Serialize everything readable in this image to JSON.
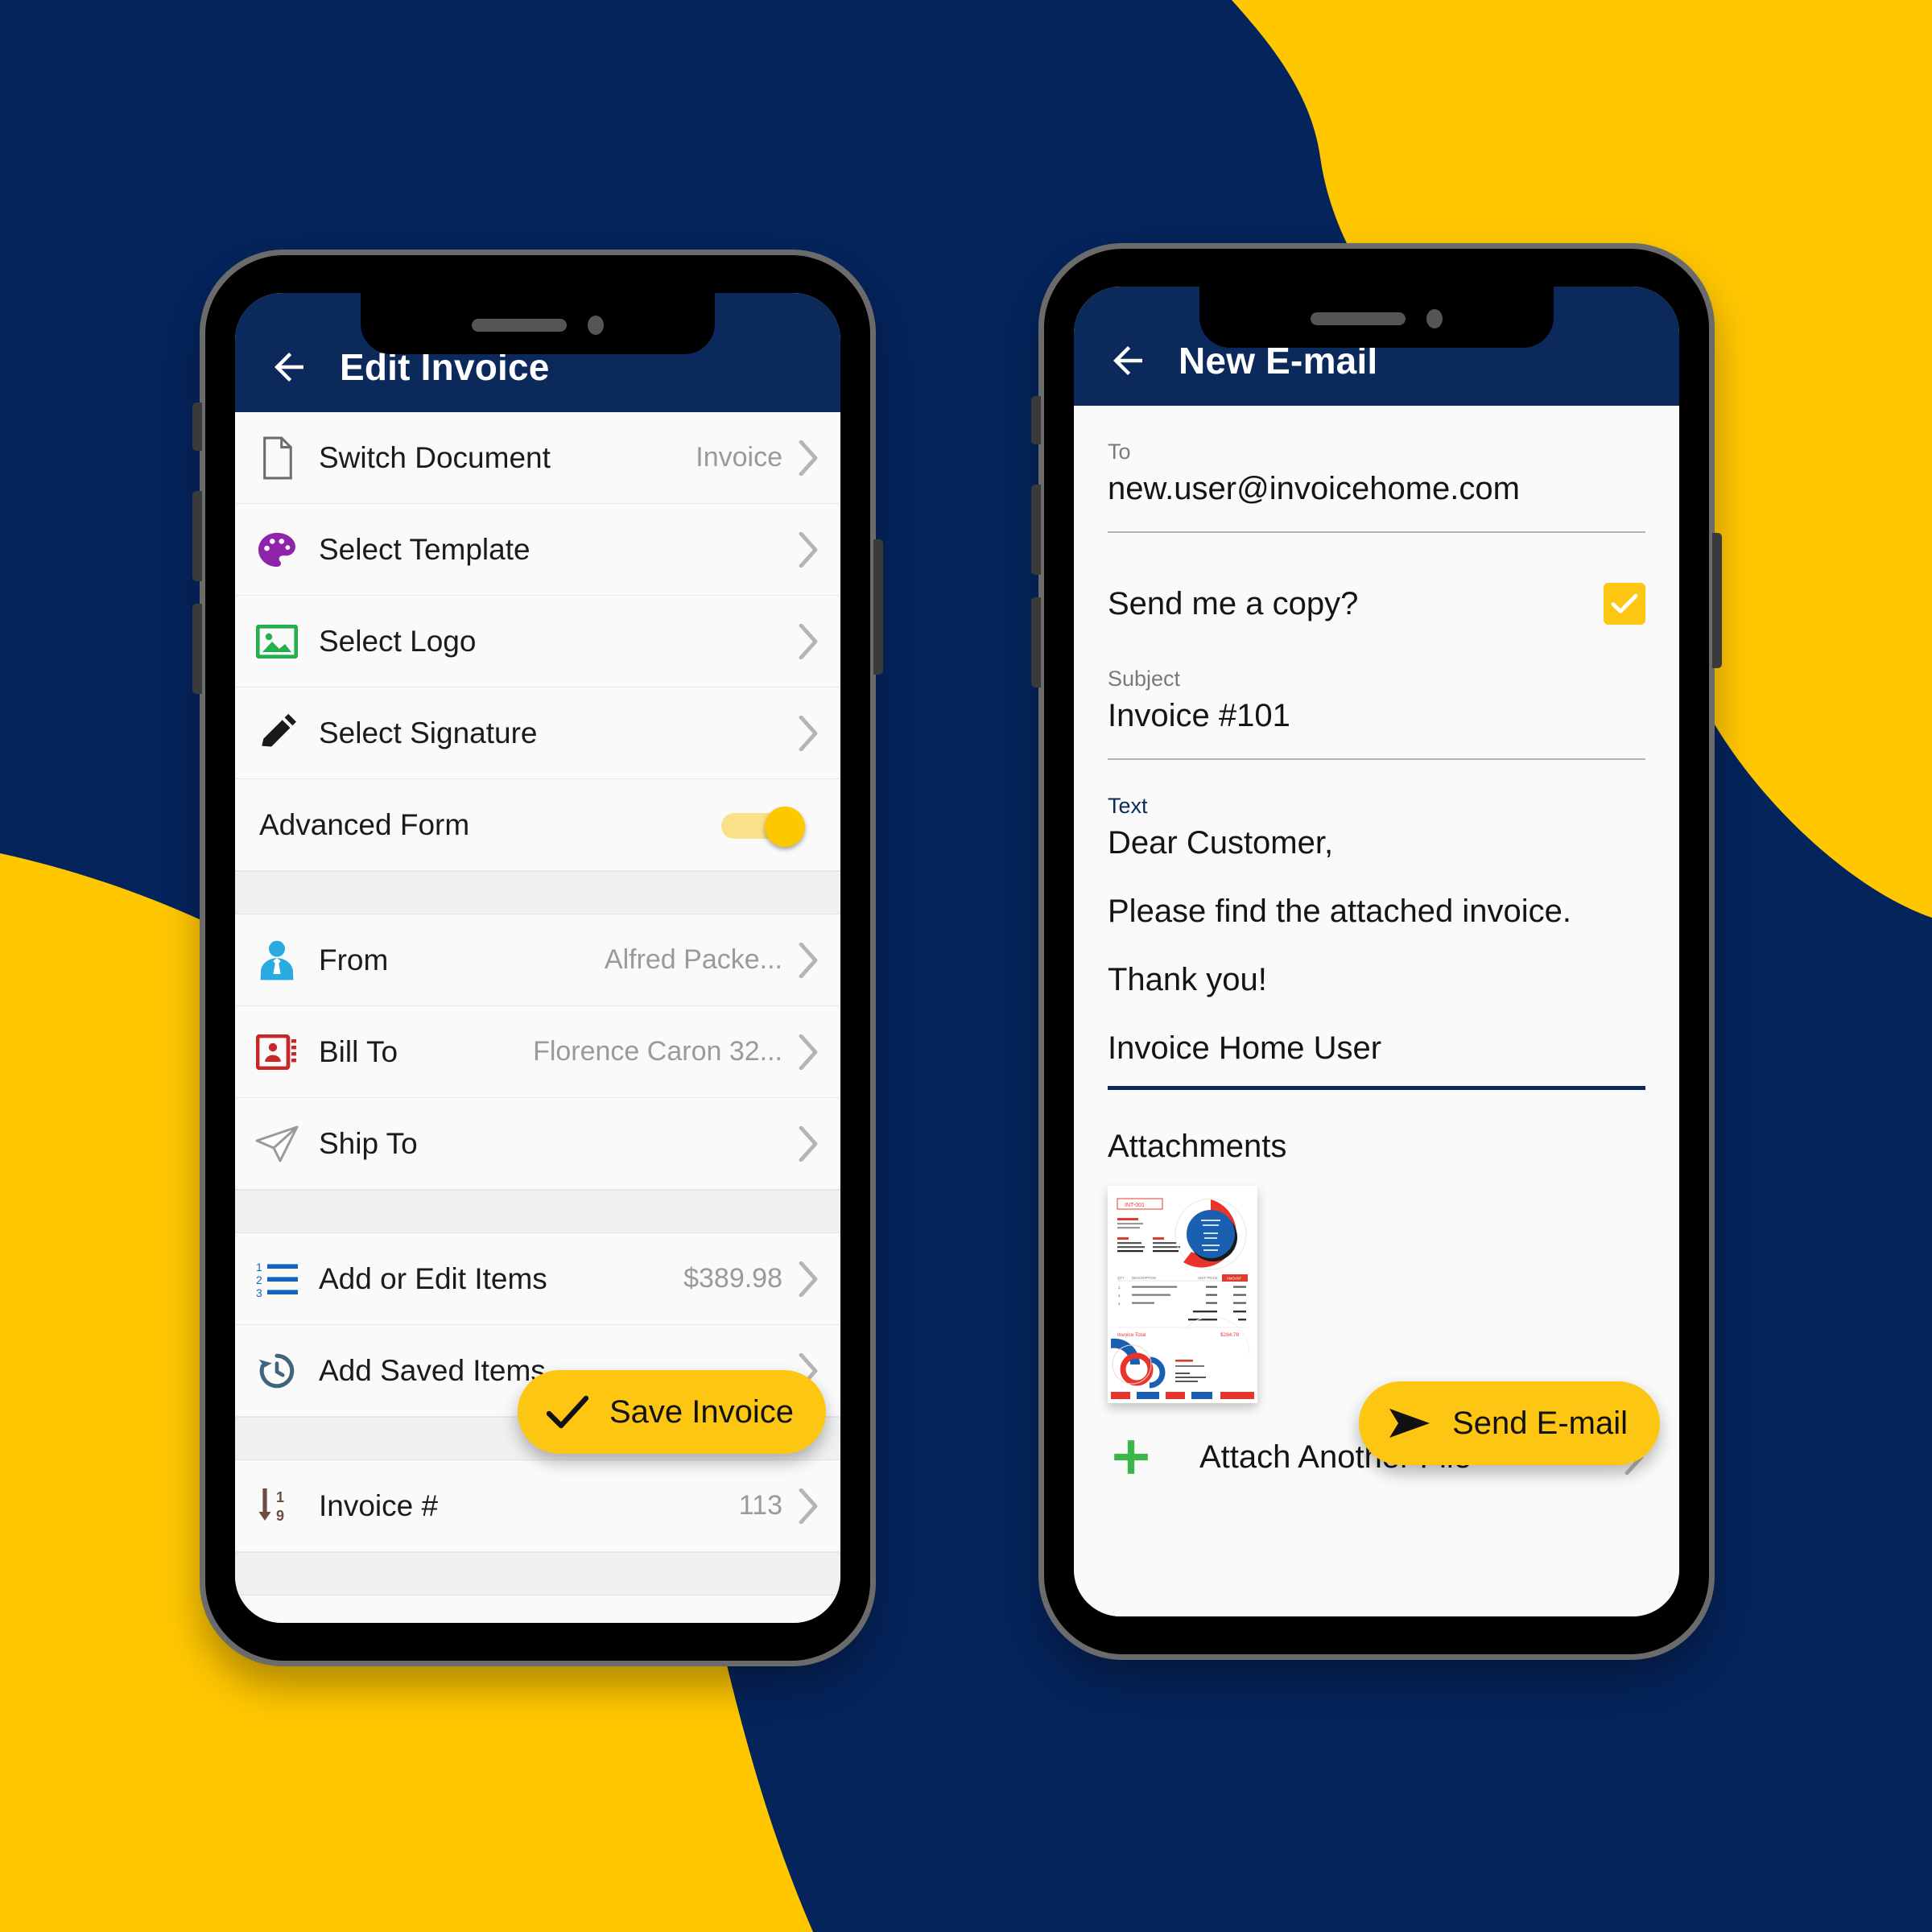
{
  "theme": {
    "navy": "#05245c",
    "appbar_navy": "#0b2a5b",
    "yellow": "#fdc613",
    "screen_bg": "#fafafa"
  },
  "phone_left": {
    "appbar": {
      "back_icon": "back-arrow-icon",
      "title": "Edit Invoice"
    },
    "rows": [
      {
        "icon": "document-icon",
        "label": "Switch Document",
        "value": "Invoice",
        "chevron": true
      },
      {
        "icon": "palette-icon",
        "label": "Select Template",
        "value": "",
        "chevron": true
      },
      {
        "icon": "image-icon",
        "label": "Select Logo",
        "value": "",
        "chevron": true
      },
      {
        "icon": "pencil-icon",
        "label": "Select Signature",
        "value": "",
        "chevron": true
      },
      {
        "icon": "",
        "label": "Advanced Form",
        "value": "",
        "toggle": true,
        "toggle_on": true
      },
      {
        "separator": true
      },
      {
        "icon": "person-tie-icon",
        "label": "From",
        "value": "Alfred Packe...",
        "chevron": true
      },
      {
        "icon": "contact-card-icon",
        "label": "Bill To",
        "value": "Florence Caron 32...",
        "chevron": true
      },
      {
        "icon": "paper-plane-icon",
        "label": "Ship To",
        "value": "",
        "chevron": true
      },
      {
        "separator": true
      },
      {
        "icon": "numbered-list-icon",
        "label": "Add or Edit Items",
        "value": "$389.98",
        "chevron": true
      },
      {
        "icon": "history-icon",
        "label": "Add Saved Items",
        "value": "",
        "chevron": true
      },
      {
        "separator": true
      },
      {
        "icon": "sort-numeric-icon",
        "label": "Invoice #",
        "value": "113",
        "chevron": true
      }
    ],
    "fab": {
      "icon": "check-icon",
      "label": "Save Invoice"
    }
  },
  "phone_right": {
    "appbar": {
      "back_icon": "back-arrow-icon",
      "title": "New E-mail"
    },
    "to": {
      "label": "To",
      "value": "new.user@invoicehome.com"
    },
    "send_copy": {
      "label": "Send me a copy?",
      "checked": true,
      "check_icon": "check-icon"
    },
    "subject": {
      "label": "Subject",
      "value": "Invoice #101"
    },
    "text": {
      "label": "Text",
      "lines": [
        "Dear Customer,",
        "Please find the attached invoice.",
        "Thank you!",
        "Invoice Home User"
      ]
    },
    "attachments": {
      "title": "Attachments",
      "thumbnail_name": "invoice-preview-thumbnail",
      "thumbnail_doc": {
        "doc_number": "INT-001",
        "total_label": "Invoice Total",
        "total_value": "$284.78"
      },
      "attach_more": {
        "icon": "plus-icon",
        "label": "Attach Another File",
        "chevron": true
      }
    },
    "fab": {
      "icon": "send-icon",
      "label": "Send E-mail"
    }
  }
}
